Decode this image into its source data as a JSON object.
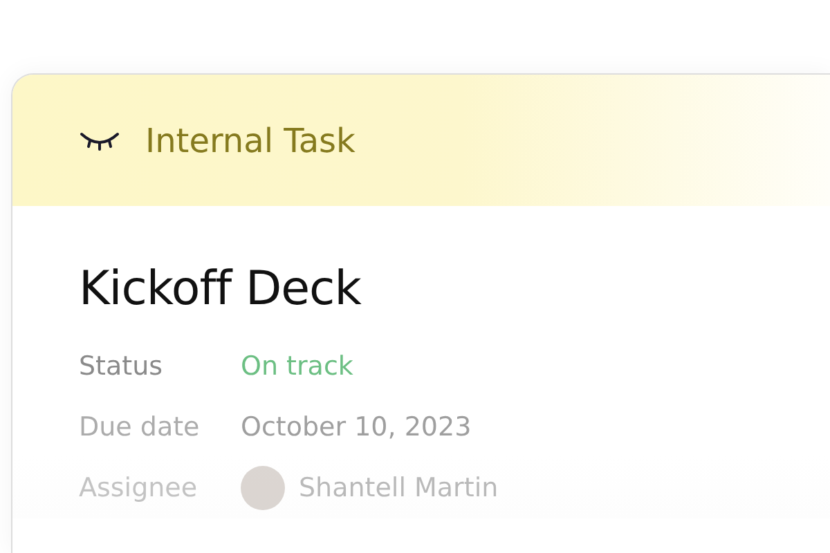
{
  "header": {
    "title": "Internal Task"
  },
  "task": {
    "title": "Kickoff Deck"
  },
  "fields": [
    {
      "label": "Status",
      "value": "On track",
      "kind": "status",
      "color": "#6cbf83"
    },
    {
      "label": "Due date",
      "value": "October 10, 2023",
      "kind": "date"
    },
    {
      "label": "Assignee",
      "value": "Shantell Martin",
      "kind": "person"
    }
  ]
}
